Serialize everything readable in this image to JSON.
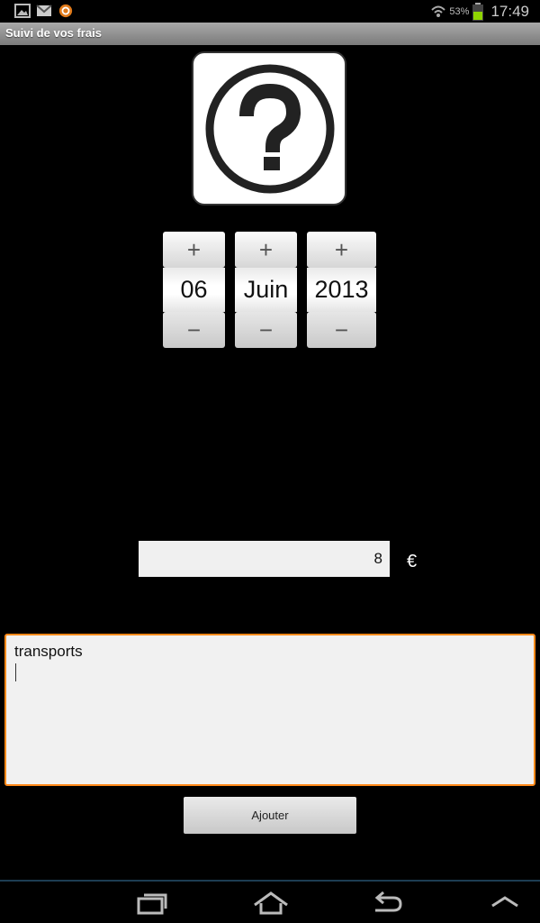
{
  "status_bar": {
    "left_icons": [
      "image-icon",
      "gmail-icon",
      "app-notification-icon"
    ],
    "battery_percent": "53%",
    "time": "17:49"
  },
  "title_bar": {
    "title": "Suivi de vos frais"
  },
  "category_image": {
    "icon": "question-mark-icon"
  },
  "date": {
    "day": "06",
    "month": "Juin",
    "year": "2013",
    "increment_label": "+",
    "decrement_label": "−"
  },
  "amount": {
    "value": "8",
    "currency": "€"
  },
  "description": {
    "value": "transports"
  },
  "add_button": {
    "label": "Ajouter"
  },
  "nav_bar": {
    "icons": [
      "recent-apps-icon",
      "home-icon",
      "back-icon",
      "menu-up-icon"
    ]
  },
  "colors": {
    "focus_border": "#ff8a1a",
    "background": "#000000"
  }
}
